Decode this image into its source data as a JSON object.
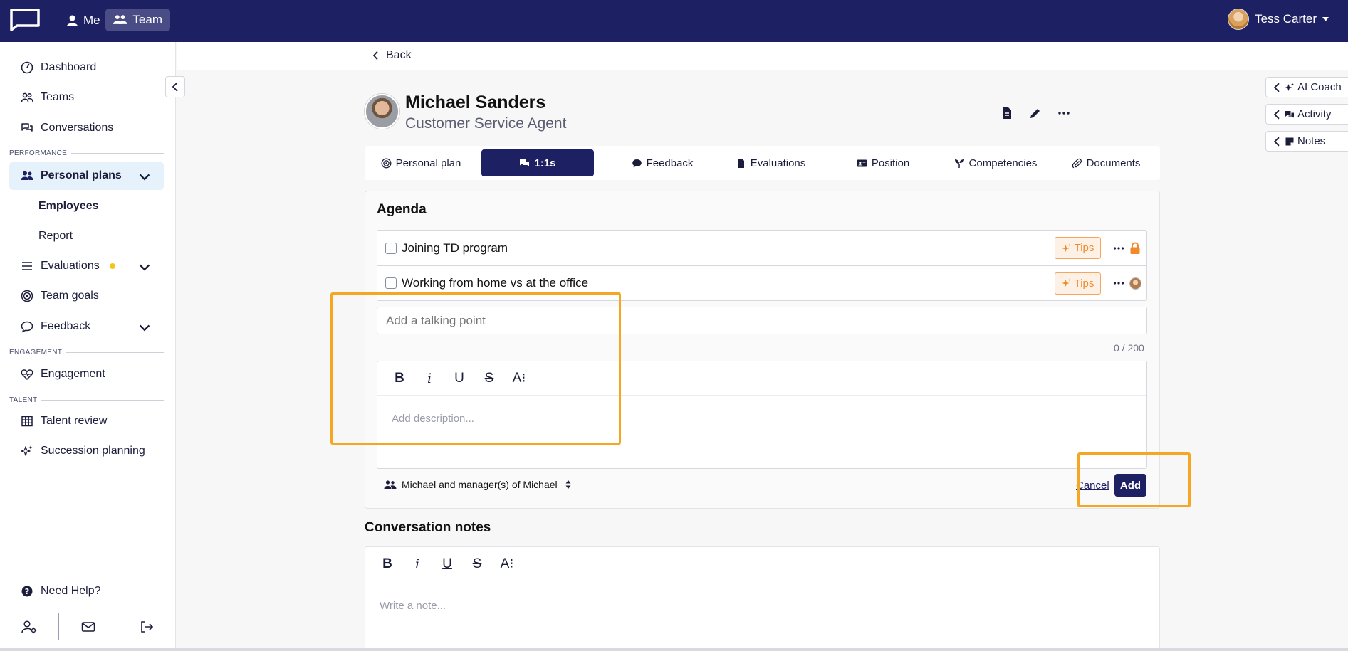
{
  "topbar": {
    "me_label": "Me",
    "team_label": "Team",
    "user_name": "Tess Carter"
  },
  "sidebar": {
    "items": [
      {
        "label": "Dashboard",
        "icon": "gauge-icon"
      },
      {
        "label": "Teams",
        "icon": "users-icon"
      },
      {
        "label": "Conversations",
        "icon": "chat-icon"
      }
    ],
    "section_performance": "PERFORMANCE",
    "personal_plans": "Personal plans",
    "employees": "Employees",
    "report": "Report",
    "evaluations": "Evaluations",
    "team_goals": "Team goals",
    "feedback": "Feedback",
    "section_engagement": "ENGAGEMENT",
    "engagement": "Engagement",
    "section_talent": "TALENT",
    "talent_review": "Talent review",
    "succession_planning": "Succession planning",
    "need_help": "Need Help?"
  },
  "main": {
    "back_label": "Back",
    "profile": {
      "name": "Michael Sanders",
      "role": "Customer Service Agent"
    },
    "tabs": [
      {
        "label": "Personal plan",
        "icon": "target-icon"
      },
      {
        "label": "1:1s",
        "icon": "chat-icon"
      },
      {
        "label": "Feedback",
        "icon": "comment-icon"
      },
      {
        "label": "Evaluations",
        "icon": "file-icon"
      },
      {
        "label": "Position",
        "icon": "id-card-icon"
      },
      {
        "label": "Competencies",
        "icon": "seedling-icon"
      },
      {
        "label": "Documents",
        "icon": "paperclip-icon"
      }
    ],
    "active_tab": "1:1s",
    "agenda": {
      "title": "Agenda",
      "items": [
        {
          "text": "Joining TD program",
          "tips": "Tips",
          "end_icon": "lock-icon"
        },
        {
          "text": "Working from home vs at the office",
          "tips": "Tips",
          "end_icon": "avatar"
        }
      ],
      "talking_point_placeholder": "Add a talking point",
      "counter": "0 / 200",
      "description_placeholder": "Add description...",
      "visibility": "Michael and manager(s) of Michael",
      "cancel_label": "Cancel",
      "add_label": "Add"
    },
    "notes": {
      "title": "Conversation notes",
      "placeholder": "Write a note..."
    },
    "toolbar": {
      "bold": "B",
      "italic": "i",
      "underline": "U",
      "strike": "S",
      "size": "A⁝"
    }
  },
  "drawers": [
    {
      "label": "AI Coach",
      "icon": "sparkle-icon"
    },
    {
      "label": "Activity",
      "icon": "chat-icon"
    },
    {
      "label": "Notes",
      "icon": "sticky-note-icon"
    }
  ],
  "colors": {
    "navy": "#1e2064",
    "accent_orange": "#f5a623",
    "tips_orange": "#f08a2c",
    "active_bg": "#e5f1fb"
  }
}
